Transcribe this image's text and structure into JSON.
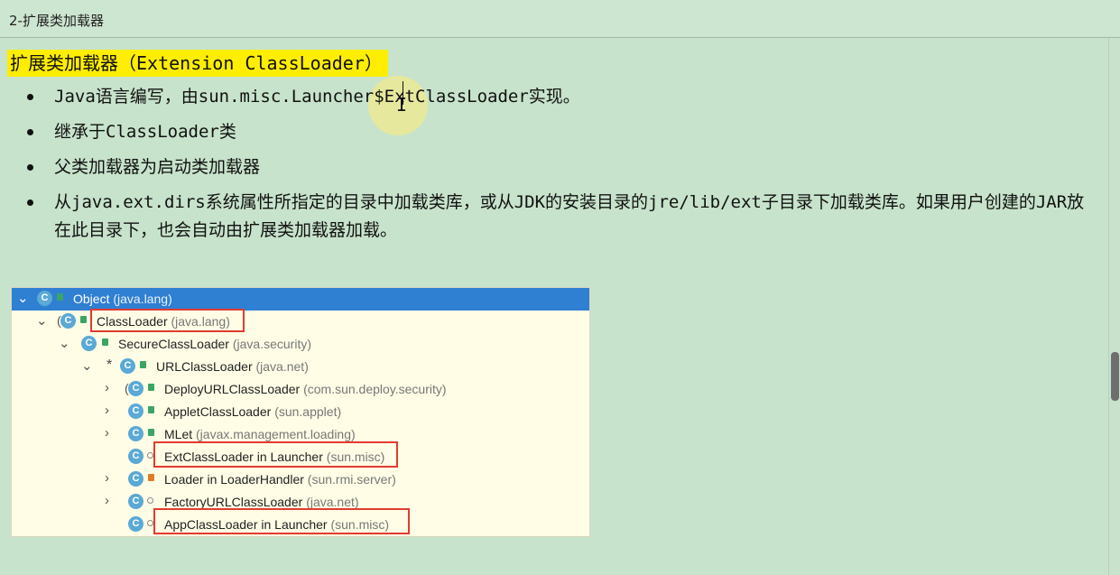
{
  "window": {
    "title": "2-扩展类加载器"
  },
  "content": {
    "heading": "扩展类加载器（Extension ClassLoader）",
    "bullets": [
      "Java语言编写，由sun.misc.Launcher$ExtClassLoader实现。",
      "继承于ClassLoader类",
      "父类加载器为启动类加载器",
      "从java.ext.dirs系统属性所指定的目录中加载类库，或从JDK的安装目录的jre/lib/ext子目录下加载类库。如果用户创建的JAR放在此目录下，也会自动由扩展类加载器加载。"
    ]
  },
  "tree": {
    "rows": [
      {
        "name": "Object",
        "pkg": "(java.lang)"
      },
      {
        "name": "ClassLoader",
        "pkg": "(java.lang)"
      },
      {
        "name": "SecureClassLoader",
        "pkg": "(java.security)"
      },
      {
        "name": "URLClassLoader",
        "pkg": "(java.net)"
      },
      {
        "name": "DeployURLClassLoader",
        "pkg": "(com.sun.deploy.security)"
      },
      {
        "name": "AppletClassLoader",
        "pkg": "(sun.applet)"
      },
      {
        "name": "MLet",
        "pkg": "(javax.management.loading)"
      },
      {
        "name": "ExtClassLoader in Launcher",
        "pkg": "(sun.misc)"
      },
      {
        "name": "Loader in LoaderHandler",
        "pkg": "(sun.rmi.server)"
      },
      {
        "name": "FactoryURLClassLoader",
        "pkg": "(java.net)"
      },
      {
        "name": "AppClassLoader in Launcher",
        "pkg": "(sun.misc)"
      }
    ]
  },
  "colors": {
    "background": "#c7e3cb",
    "highlight": "#ffee00",
    "selection": "#2f7fd3",
    "redbox": "#e23b2e"
  }
}
